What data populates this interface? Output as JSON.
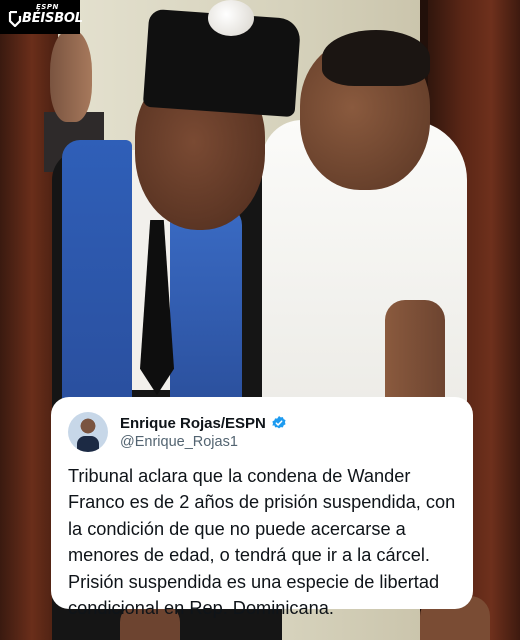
{
  "badge": {
    "network": "ESPN",
    "section": "BÉISBOL"
  },
  "tweet": {
    "display_name": "Enrique Rojas/ESPN",
    "verified": true,
    "handle": "@Enrique_Rojas1",
    "text_lines": [
      "Tribunal aclara que la condena de Wander",
      "Franco es de 2 años de prisión suspendida, con",
      "la condición de que no puede acercarse a",
      "menores de edad, o tendrá que ir a la cárcel.",
      "Prisión suspendida es una especie de libertad",
      "condicional en Rep. Dominicana."
    ]
  },
  "colors": {
    "verified_blue": "#1d9bf0",
    "text": "#0f1419",
    "handle_gray": "#536471",
    "card_bg": "#ffffff"
  }
}
